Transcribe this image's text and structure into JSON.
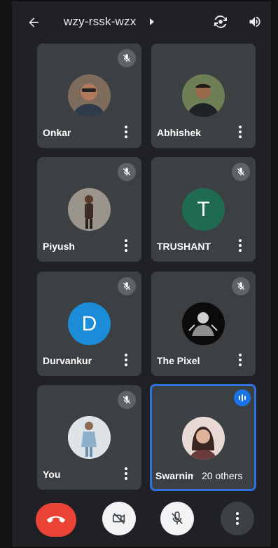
{
  "header": {
    "title": "wzy-rssk-wzx"
  },
  "participants": [
    {
      "name": "Onkar",
      "muted": true,
      "avatar": "photo",
      "color": "#6b5a4e"
    },
    {
      "name": "Abhishek",
      "muted": false,
      "avatar": "photo",
      "color": "#5b6a4a"
    },
    {
      "name": "Piyush",
      "muted": true,
      "avatar": "photo",
      "color": "#8a8478"
    },
    {
      "name": "TRUSHANT",
      "muted": true,
      "avatar": "letter",
      "letter": "T",
      "color": "#1e6b52"
    },
    {
      "name": "Durvankur",
      "muted": true,
      "avatar": "letter",
      "letter": "D",
      "color": "#1a8cd8"
    },
    {
      "name": "The Pixel",
      "muted": true,
      "avatar": "photo",
      "color": "#111111"
    },
    {
      "name": "You",
      "muted": true,
      "avatar": "photo",
      "color": "#c9d4dc"
    },
    {
      "name": "Swarnim",
      "muted": false,
      "speaking": true,
      "avatar": "photo",
      "color": "#d9c6c4"
    }
  ],
  "others_pill": "20 others",
  "controls": {
    "end_call_color": "#ea4335",
    "camera": "camera-off",
    "mic": "mic-off",
    "more": "more-options"
  },
  "colors": {
    "active_border": "#2f6fde",
    "tile_bg": "#3c4043",
    "bg": "#202124"
  }
}
